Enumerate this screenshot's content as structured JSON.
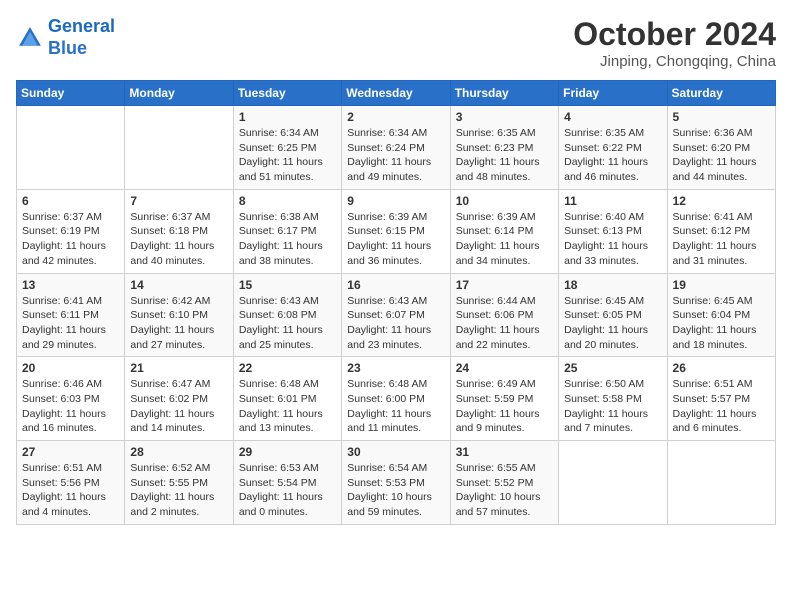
{
  "header": {
    "logo_line1": "General",
    "logo_line2": "Blue",
    "month": "October 2024",
    "location": "Jinping, Chongqing, China"
  },
  "weekdays": [
    "Sunday",
    "Monday",
    "Tuesday",
    "Wednesday",
    "Thursday",
    "Friday",
    "Saturday"
  ],
  "weeks": [
    [
      {
        "day": "",
        "info": ""
      },
      {
        "day": "",
        "info": ""
      },
      {
        "day": "1",
        "info": "Sunrise: 6:34 AM\nSunset: 6:25 PM\nDaylight: 11 hours and 51 minutes."
      },
      {
        "day": "2",
        "info": "Sunrise: 6:34 AM\nSunset: 6:24 PM\nDaylight: 11 hours and 49 minutes."
      },
      {
        "day": "3",
        "info": "Sunrise: 6:35 AM\nSunset: 6:23 PM\nDaylight: 11 hours and 48 minutes."
      },
      {
        "day": "4",
        "info": "Sunrise: 6:35 AM\nSunset: 6:22 PM\nDaylight: 11 hours and 46 minutes."
      },
      {
        "day": "5",
        "info": "Sunrise: 6:36 AM\nSunset: 6:20 PM\nDaylight: 11 hours and 44 minutes."
      }
    ],
    [
      {
        "day": "6",
        "info": "Sunrise: 6:37 AM\nSunset: 6:19 PM\nDaylight: 11 hours and 42 minutes."
      },
      {
        "day": "7",
        "info": "Sunrise: 6:37 AM\nSunset: 6:18 PM\nDaylight: 11 hours and 40 minutes."
      },
      {
        "day": "8",
        "info": "Sunrise: 6:38 AM\nSunset: 6:17 PM\nDaylight: 11 hours and 38 minutes."
      },
      {
        "day": "9",
        "info": "Sunrise: 6:39 AM\nSunset: 6:15 PM\nDaylight: 11 hours and 36 minutes."
      },
      {
        "day": "10",
        "info": "Sunrise: 6:39 AM\nSunset: 6:14 PM\nDaylight: 11 hours and 34 minutes."
      },
      {
        "day": "11",
        "info": "Sunrise: 6:40 AM\nSunset: 6:13 PM\nDaylight: 11 hours and 33 minutes."
      },
      {
        "day": "12",
        "info": "Sunrise: 6:41 AM\nSunset: 6:12 PM\nDaylight: 11 hours and 31 minutes."
      }
    ],
    [
      {
        "day": "13",
        "info": "Sunrise: 6:41 AM\nSunset: 6:11 PM\nDaylight: 11 hours and 29 minutes."
      },
      {
        "day": "14",
        "info": "Sunrise: 6:42 AM\nSunset: 6:10 PM\nDaylight: 11 hours and 27 minutes."
      },
      {
        "day": "15",
        "info": "Sunrise: 6:43 AM\nSunset: 6:08 PM\nDaylight: 11 hours and 25 minutes."
      },
      {
        "day": "16",
        "info": "Sunrise: 6:43 AM\nSunset: 6:07 PM\nDaylight: 11 hours and 23 minutes."
      },
      {
        "day": "17",
        "info": "Sunrise: 6:44 AM\nSunset: 6:06 PM\nDaylight: 11 hours and 22 minutes."
      },
      {
        "day": "18",
        "info": "Sunrise: 6:45 AM\nSunset: 6:05 PM\nDaylight: 11 hours and 20 minutes."
      },
      {
        "day": "19",
        "info": "Sunrise: 6:45 AM\nSunset: 6:04 PM\nDaylight: 11 hours and 18 minutes."
      }
    ],
    [
      {
        "day": "20",
        "info": "Sunrise: 6:46 AM\nSunset: 6:03 PM\nDaylight: 11 hours and 16 minutes."
      },
      {
        "day": "21",
        "info": "Sunrise: 6:47 AM\nSunset: 6:02 PM\nDaylight: 11 hours and 14 minutes."
      },
      {
        "day": "22",
        "info": "Sunrise: 6:48 AM\nSunset: 6:01 PM\nDaylight: 11 hours and 13 minutes."
      },
      {
        "day": "23",
        "info": "Sunrise: 6:48 AM\nSunset: 6:00 PM\nDaylight: 11 hours and 11 minutes."
      },
      {
        "day": "24",
        "info": "Sunrise: 6:49 AM\nSunset: 5:59 PM\nDaylight: 11 hours and 9 minutes."
      },
      {
        "day": "25",
        "info": "Sunrise: 6:50 AM\nSunset: 5:58 PM\nDaylight: 11 hours and 7 minutes."
      },
      {
        "day": "26",
        "info": "Sunrise: 6:51 AM\nSunset: 5:57 PM\nDaylight: 11 hours and 6 minutes."
      }
    ],
    [
      {
        "day": "27",
        "info": "Sunrise: 6:51 AM\nSunset: 5:56 PM\nDaylight: 11 hours and 4 minutes."
      },
      {
        "day": "28",
        "info": "Sunrise: 6:52 AM\nSunset: 5:55 PM\nDaylight: 11 hours and 2 minutes."
      },
      {
        "day": "29",
        "info": "Sunrise: 6:53 AM\nSunset: 5:54 PM\nDaylight: 11 hours and 0 minutes."
      },
      {
        "day": "30",
        "info": "Sunrise: 6:54 AM\nSunset: 5:53 PM\nDaylight: 10 hours and 59 minutes."
      },
      {
        "day": "31",
        "info": "Sunrise: 6:55 AM\nSunset: 5:52 PM\nDaylight: 10 hours and 57 minutes."
      },
      {
        "day": "",
        "info": ""
      },
      {
        "day": "",
        "info": ""
      }
    ]
  ]
}
